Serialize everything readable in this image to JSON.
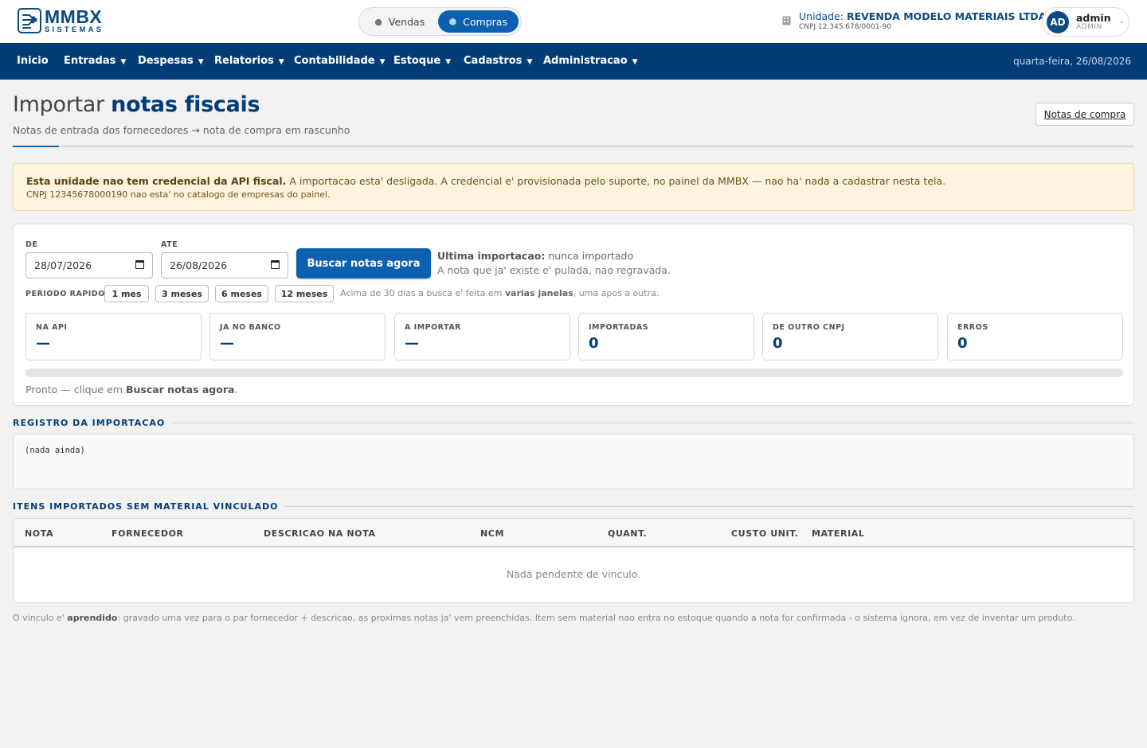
{
  "brand": {
    "name": "MMBX",
    "sub": "SISTEMAS"
  },
  "mode_switch": {
    "vendas": {
      "label": "Vendas",
      "icon": "bag-icon"
    },
    "compras": {
      "label": "Compras",
      "icon": "box-icon",
      "active": true
    }
  },
  "unit": {
    "prefix": "Unidade:",
    "name": "REVENDA MODELO MATERIAIS LTDA",
    "cnpj": "CNPJ 12.345.678/0001-90"
  },
  "user": {
    "initials": "AD",
    "name": "admin",
    "role": "ADMIN"
  },
  "nav": {
    "items": [
      {
        "label": "Inicio",
        "has_caret": false
      },
      {
        "label": "Entradas",
        "has_caret": true
      },
      {
        "label": "Despesas",
        "has_caret": true
      },
      {
        "label": "Relatorios",
        "has_caret": true
      },
      {
        "label": "Contabilidade",
        "has_caret": true
      },
      {
        "label": "Estoque",
        "has_caret": true
      },
      {
        "label": "Cadastros",
        "has_caret": true
      },
      {
        "label": "Administracao",
        "has_caret": true
      }
    ],
    "date": "quarta-feira, 26/08/2026"
  },
  "header": {
    "title_light": "Importar",
    "title_bold": "notas fiscais",
    "subtitle": "Notas de entrada dos fornecedores → nota de compra em rascunho",
    "link_button": "Notas de compra"
  },
  "alert": {
    "bold": "Esta unidade nao tem credencial da API fiscal.",
    "text": "A importacao esta' desligada. A credencial e' provisionada pelo suporte, no painel da MMBX — nao ha' nada a cadastrar nesta tela.",
    "line2": "CNPJ 12345678000190 nao esta' no catalogo de empresas do painel."
  },
  "search": {
    "de_label": "DE",
    "de_value": "28/07/2026",
    "ate_label": "ATE",
    "ate_value": "26/08/2026",
    "button": "Buscar notas agora",
    "last_import_label": "Ultima importacao:",
    "last_import_value": "nunca importado",
    "skip_note": "A nota que ja' existe e' pulada, nao regravada.",
    "quick_label": "PERIODO RAPIDO",
    "quick": [
      "1 mes",
      "3 meses",
      "6 meses",
      "12 meses"
    ],
    "quick_note_pre": "Acima de 30 dias a busca e' feita em",
    "quick_note_bold": "varias janelas",
    "quick_note_post": ", uma apos a outra."
  },
  "stats": [
    {
      "label": "NA API",
      "value": "—"
    },
    {
      "label": "JA NO BANCO",
      "value": "—"
    },
    {
      "label": "A IMPORTAR",
      "value": "—"
    },
    {
      "label": "IMPORTADAS",
      "value": "0"
    },
    {
      "label": "DE OUTRO CNPJ",
      "value": "0"
    },
    {
      "label": "ERROS",
      "value": "0"
    }
  ],
  "progress_fraction": 0,
  "status": {
    "pre": "Pronto — clique em",
    "bold": "Buscar notas agora",
    "post": "."
  },
  "log": {
    "title": "REGISTRO DA IMPORTACAO",
    "text": "(nada ainda)"
  },
  "unlinked": {
    "title": "ITENS IMPORTADOS SEM MATERIAL VINCULADO",
    "columns": [
      "NOTA",
      "FORNECEDOR",
      "DESCRICAO NA NOTA",
      "NCM",
      "QUANT.",
      "CUSTO UNIT.",
      "MATERIAL"
    ],
    "empty": "Nada pendente de vinculo."
  },
  "footnote": {
    "pre": "O vinculo e'",
    "bold": "aprendido",
    "post": ": gravado uma vez para o par fornecedor + descricao, as proximas notas ja' vem preenchidas. Item sem material nao entra no estoque quando a nota for confirmada - o sistema ignora, em vez de inventar um produto."
  },
  "colors": {
    "navy": "#043c78",
    "primary": "#0b61b0",
    "alert_bg": "#fdf4e0"
  }
}
